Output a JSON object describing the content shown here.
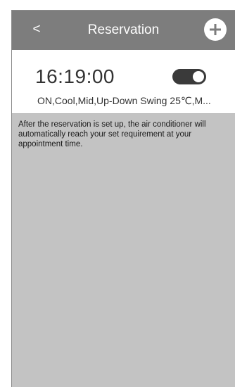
{
  "header": {
    "back_label": "<",
    "title": "Reservation",
    "add_label": "+"
  },
  "reservation": {
    "time": "16:19:00",
    "enabled": true,
    "details": "ON,Cool,Mid,Up-Down Swing 25℃,M..."
  },
  "info_text": "After the reservation is set up, the air conditioner will automatically reach your set requirement at your appointment time.",
  "colors": {
    "header_bg": "#7d7d7d",
    "page_bg": "#c3c3c3",
    "card_bg": "#ffffff",
    "toggle_on": "#3a3a3a"
  }
}
